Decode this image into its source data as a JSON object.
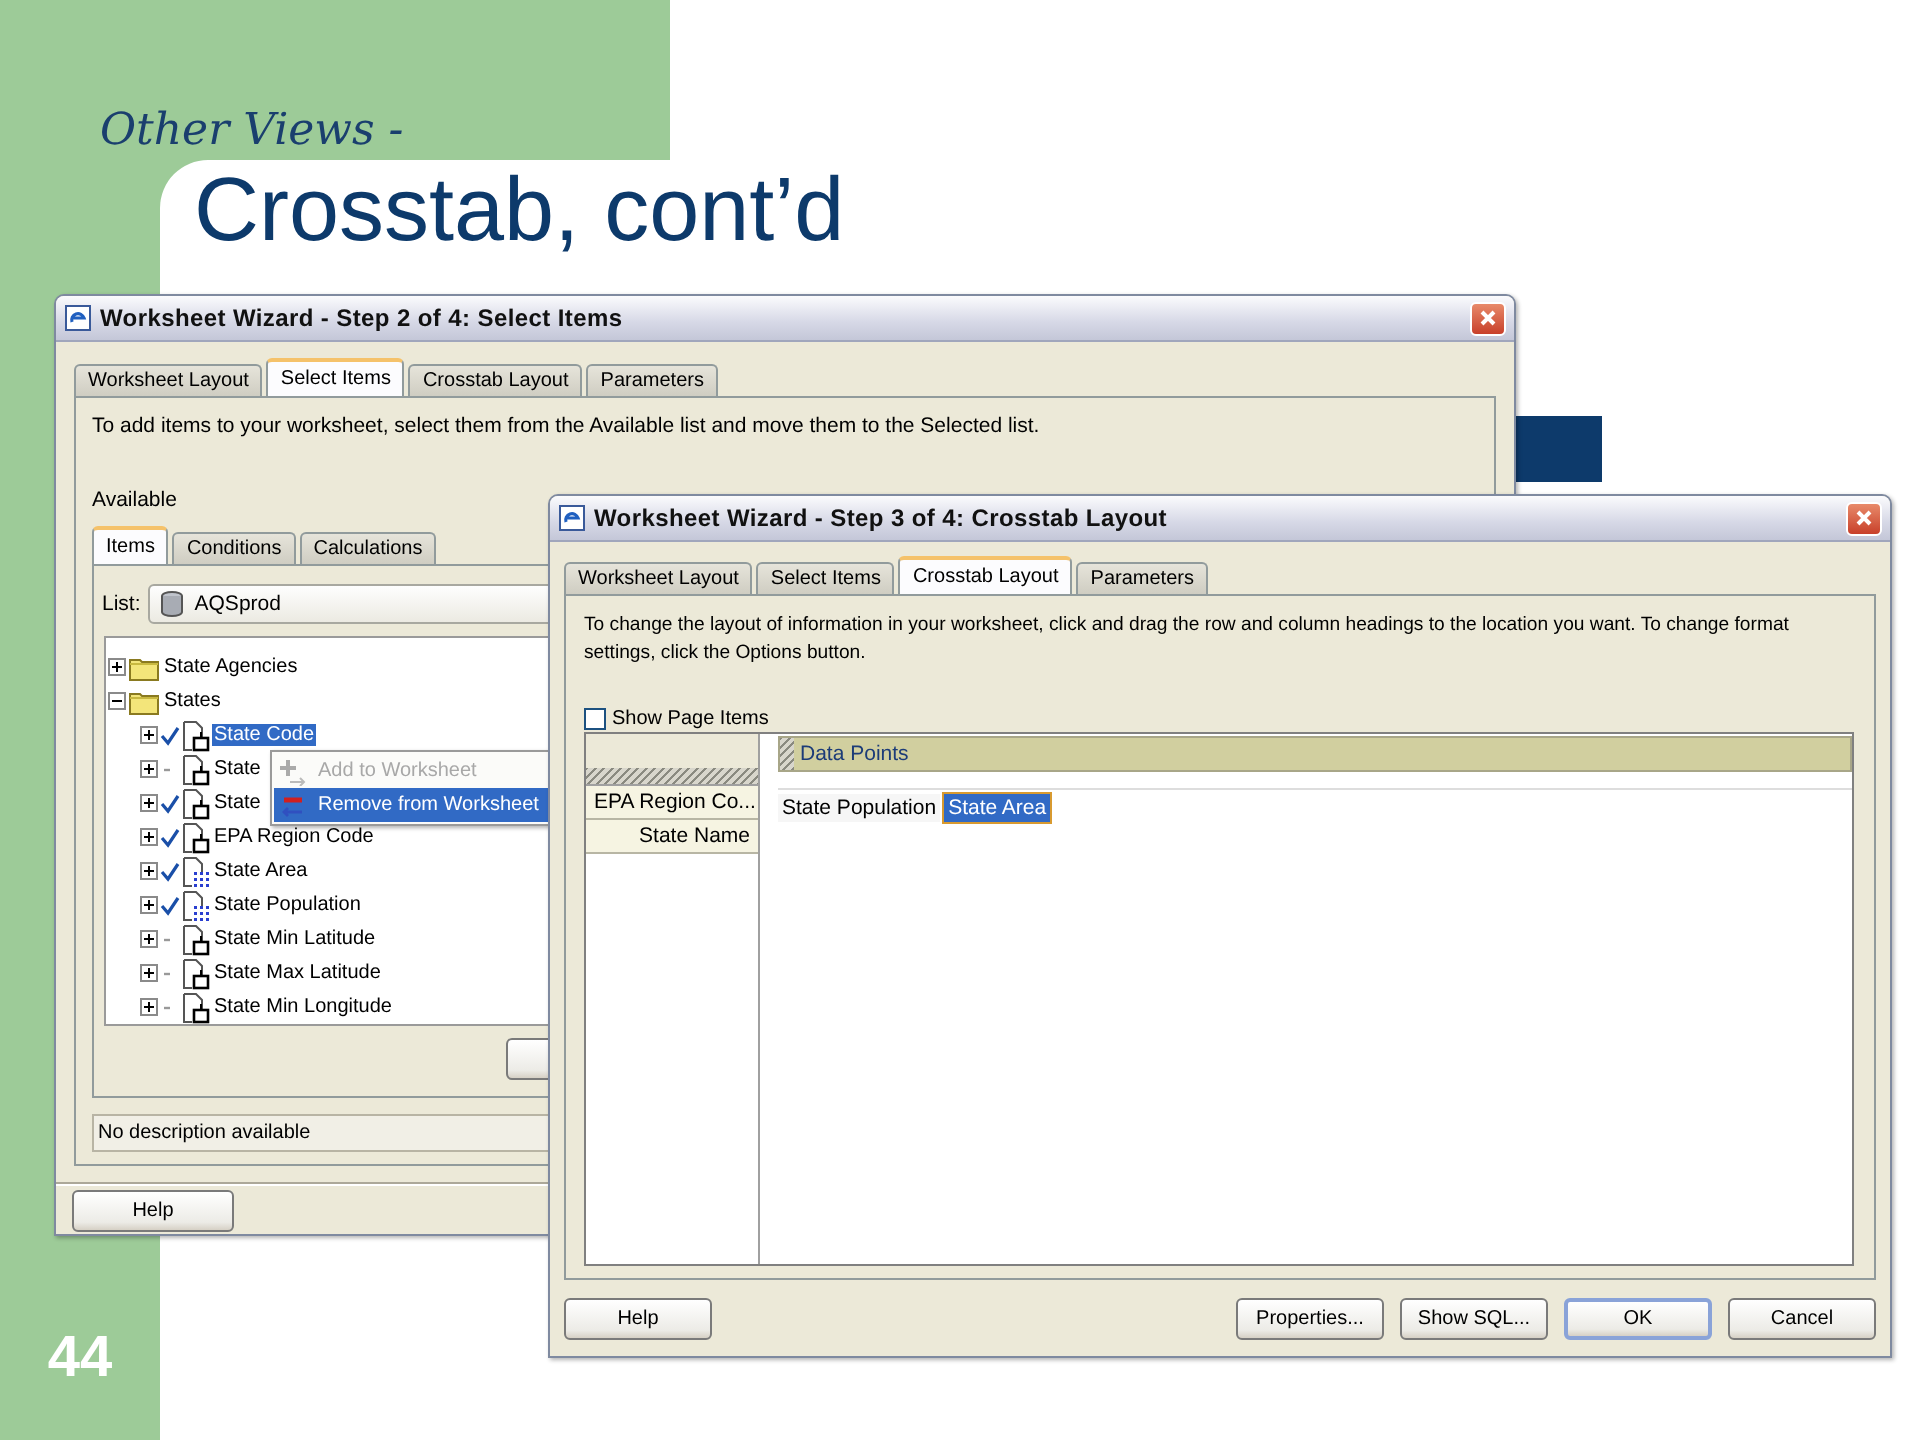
{
  "slide": {
    "subtitle": "Other Views -",
    "title": "Crosstab, cont’d",
    "page_number": "44"
  },
  "back_window": {
    "title": "Worksheet Wizard - Step 2 of 4: Select Items",
    "tabs": [
      {
        "label": "Worksheet Layout",
        "selected": false
      },
      {
        "label": "Select Items",
        "selected": true
      },
      {
        "label": "Crosstab Layout",
        "selected": false
      },
      {
        "label": "Parameters",
        "selected": false
      }
    ],
    "instructions": "To add items to your worksheet, select them from the Available list and move them to the Selected list.",
    "available_label": "Available",
    "sub_tabs": [
      {
        "label": "Items",
        "selected": true
      },
      {
        "label": "Conditions",
        "selected": false
      },
      {
        "label": "Calculations",
        "selected": false
      }
    ],
    "list_label": "List:",
    "list_value": "AQSprod",
    "tree": [
      {
        "label": "State Agencies",
        "kind": "folder",
        "expanded": false
      },
      {
        "label": "States",
        "kind": "folder",
        "expanded": true,
        "children": [
          {
            "label": "State Code",
            "kind": "item",
            "expanded": false,
            "checked": true,
            "selected": true
          },
          {
            "label": "State",
            "kind": "item",
            "expanded": false,
            "checked": false,
            "selected": false
          },
          {
            "label": "State",
            "kind": "item",
            "expanded": false,
            "checked": true,
            "selected": false
          },
          {
            "label": "EPA Region Code",
            "kind": "item",
            "expanded": false,
            "checked": true,
            "selected": false
          },
          {
            "label": "State Area",
            "kind": "measure",
            "expanded": false,
            "checked": true,
            "selected": false
          },
          {
            "label": "State Population",
            "kind": "measure",
            "expanded": false,
            "checked": true,
            "selected": false
          },
          {
            "label": "State Min Latitude",
            "kind": "item",
            "expanded": false,
            "checked": false,
            "selected": false
          },
          {
            "label": "State Max Latitude",
            "kind": "item",
            "expanded": false,
            "checked": false,
            "selected": false
          },
          {
            "label": "State Min Longitude",
            "kind": "item",
            "expanded": false,
            "checked": false,
            "selected": false
          }
        ]
      }
    ],
    "context_menu": [
      {
        "label": "Add to Worksheet",
        "kind": "add",
        "disabled": true,
        "selected": false
      },
      {
        "label": "Remove from Worksheet",
        "kind": "remove",
        "disabled": false,
        "selected": true
      }
    ],
    "description": "No description available",
    "buttons": [
      {
        "label": "Help"
      }
    ]
  },
  "front_window": {
    "title": "Worksheet Wizard - Step 3 of 4: Crosstab Layout",
    "tabs": [
      {
        "label": "Worksheet Layout",
        "selected": false
      },
      {
        "label": "Select Items",
        "selected": false
      },
      {
        "label": "Crosstab Layout",
        "selected": true
      },
      {
        "label": "Parameters",
        "selected": false
      }
    ],
    "instructions": "To change the layout of information in your worksheet, click and drag the row and column headings to the location you want. To change format settings, click the Options button.",
    "show_page_items": {
      "label": "Show Page Items",
      "checked": false
    },
    "column_header": "Data Points",
    "row_items": [
      "EPA Region Co...",
      "State Name"
    ],
    "data_points": [
      {
        "label": "State Population",
        "selected": false
      },
      {
        "label": "State Area",
        "selected": true
      }
    ],
    "buttons": [
      {
        "label": "Help",
        "default": false
      },
      {
        "label": "Properties...",
        "default": false
      },
      {
        "label": "Show SQL...",
        "default": false
      },
      {
        "label": "OK",
        "default": true
      },
      {
        "label": "Cancel",
        "default": false
      }
    ]
  }
}
